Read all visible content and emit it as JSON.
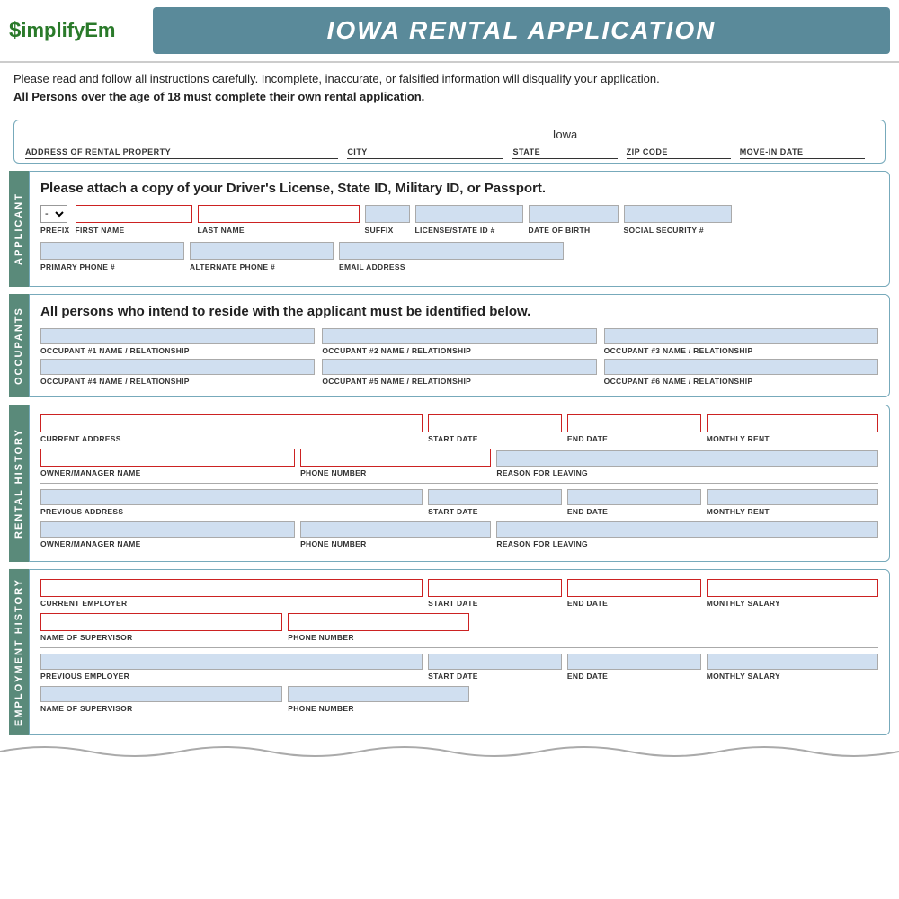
{
  "header": {
    "logo_dollar": "$",
    "logo_name": "implifyEm",
    "title": "IOWA RENTAL APPLICATION"
  },
  "instructions": {
    "line1": "Please read and follow all instructions carefully. Incomplete, inaccurate, or falsified information will disqualify your application.",
    "line2": "All Persons over the age of 18 must complete their own rental application."
  },
  "property": {
    "state_value": "Iowa",
    "fields": [
      {
        "label": "ADDRESS OF RENTAL PROPERTY",
        "value": ""
      },
      {
        "label": "CITY",
        "value": ""
      },
      {
        "label": "STATE",
        "value": "Iowa"
      },
      {
        "label": "ZIP CODE",
        "value": ""
      },
      {
        "label": "MOVE-IN DATE",
        "value": ""
      }
    ]
  },
  "applicant": {
    "side_tab": "APPLICANT",
    "heading": "Please attach a copy of your Driver's License, State ID, Military ID, or Passport.",
    "row1_fields": [
      {
        "label": "PREFIX",
        "type": "dropdown",
        "width": "narrow"
      },
      {
        "label": "FIRST NAME",
        "type": "red-input",
        "width": "medium"
      },
      {
        "label": "LAST NAME",
        "type": "red-input",
        "width": "large"
      },
      {
        "label": "SUFFIX",
        "type": "blue-input",
        "width": "small"
      },
      {
        "label": "LICENSE/STATE ID #",
        "type": "blue-input",
        "width": "medium"
      },
      {
        "label": "DATE OF BIRTH",
        "type": "blue-input",
        "width": "medium"
      },
      {
        "label": "SOCIAL SECURITY #",
        "type": "blue-input",
        "width": "medium"
      }
    ],
    "row2_fields": [
      {
        "label": "PRIMARY PHONE #",
        "type": "blue-input",
        "width": "medium"
      },
      {
        "label": "ALTERNATE PHONE #",
        "type": "blue-input",
        "width": "medium"
      },
      {
        "label": "EMAIL ADDRESS",
        "type": "blue-input",
        "width": "large"
      }
    ]
  },
  "occupants": {
    "side_tab": "OCCUPANTS",
    "heading": "All persons who intend to reside with the applicant must be identified below.",
    "row1": [
      {
        "label": "OCCUPANT #1 NAME / RELATIONSHIP"
      },
      {
        "label": "OCCUPANT #2 NAME / RELATIONSHIP"
      },
      {
        "label": "OCCUPANT #3 NAME / RELATIONSHIP"
      }
    ],
    "row2": [
      {
        "label": "OCCUPANT #4 NAME / RELATIONSHIP"
      },
      {
        "label": "OCCUPANT #5 NAME / RELATIONSHIP"
      },
      {
        "label": "OCCUPANT #6 NAME / RELATIONSHIP"
      }
    ]
  },
  "rental_history": {
    "side_tab": "RENTAL HISTORY",
    "current_address_label": "CURRENT ADDRESS",
    "start_date_label": "START DATE",
    "end_date_label": "END DATE",
    "monthly_rent_label": "MONTHLY RENT",
    "owner_manager_label": "OWNER/MANAGER NAME",
    "phone_label": "PHONE NUMBER",
    "reason_label": "REASON FOR LEAVING",
    "previous_address_label": "PREVIOUS ADDRESS",
    "previous_owner_label": "OWNER/MANAGER NAME",
    "previous_phone_label": "PHONE NUMBER",
    "previous_reason_label": "REASON FOR LEAVING"
  },
  "employment_history": {
    "side_tab": "EMPLOYMENT HISTORY",
    "current_employer_label": "CURRENT EMPLOYER",
    "start_date_label": "START DATE",
    "end_date_label": "END DATE",
    "monthly_salary_label": "MONTHLY SALARY",
    "supervisor_label": "NAME OF SUPERVISOR",
    "phone_label": "PHONE NUMBER",
    "previous_employer_label": "PREVIOUS EMPLOYER",
    "prev_start_label": "START DATE",
    "prev_end_label": "END DATE",
    "prev_salary_label": "MONTHLY SALARY",
    "prev_supervisor_label": "NAME OF SUPERVISOR",
    "prev_phone_label": "PHONE NUMBER"
  }
}
